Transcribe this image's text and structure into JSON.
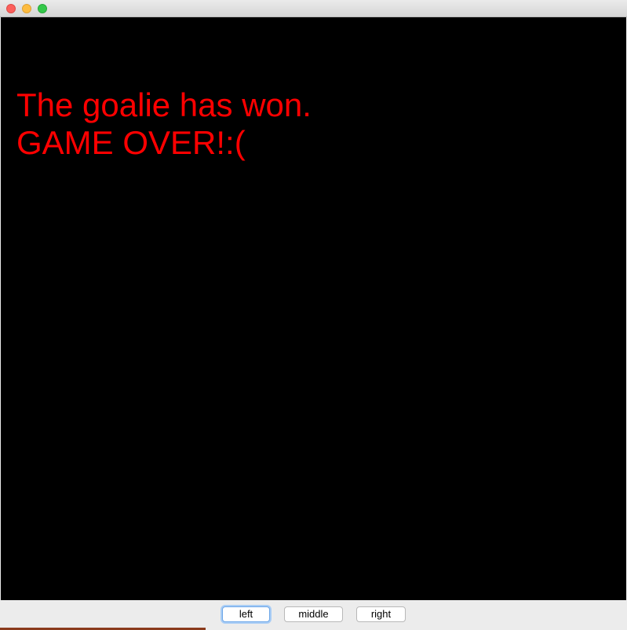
{
  "window": {
    "title": ""
  },
  "game": {
    "message_line1": "The goalie has won.",
    "message_line2": "GAME OVER!:(",
    "background_color": "#000000",
    "message_color": "#ff0000"
  },
  "controls": {
    "left_label": "left",
    "middle_label": "middle",
    "right_label": "right",
    "focused": "left"
  }
}
